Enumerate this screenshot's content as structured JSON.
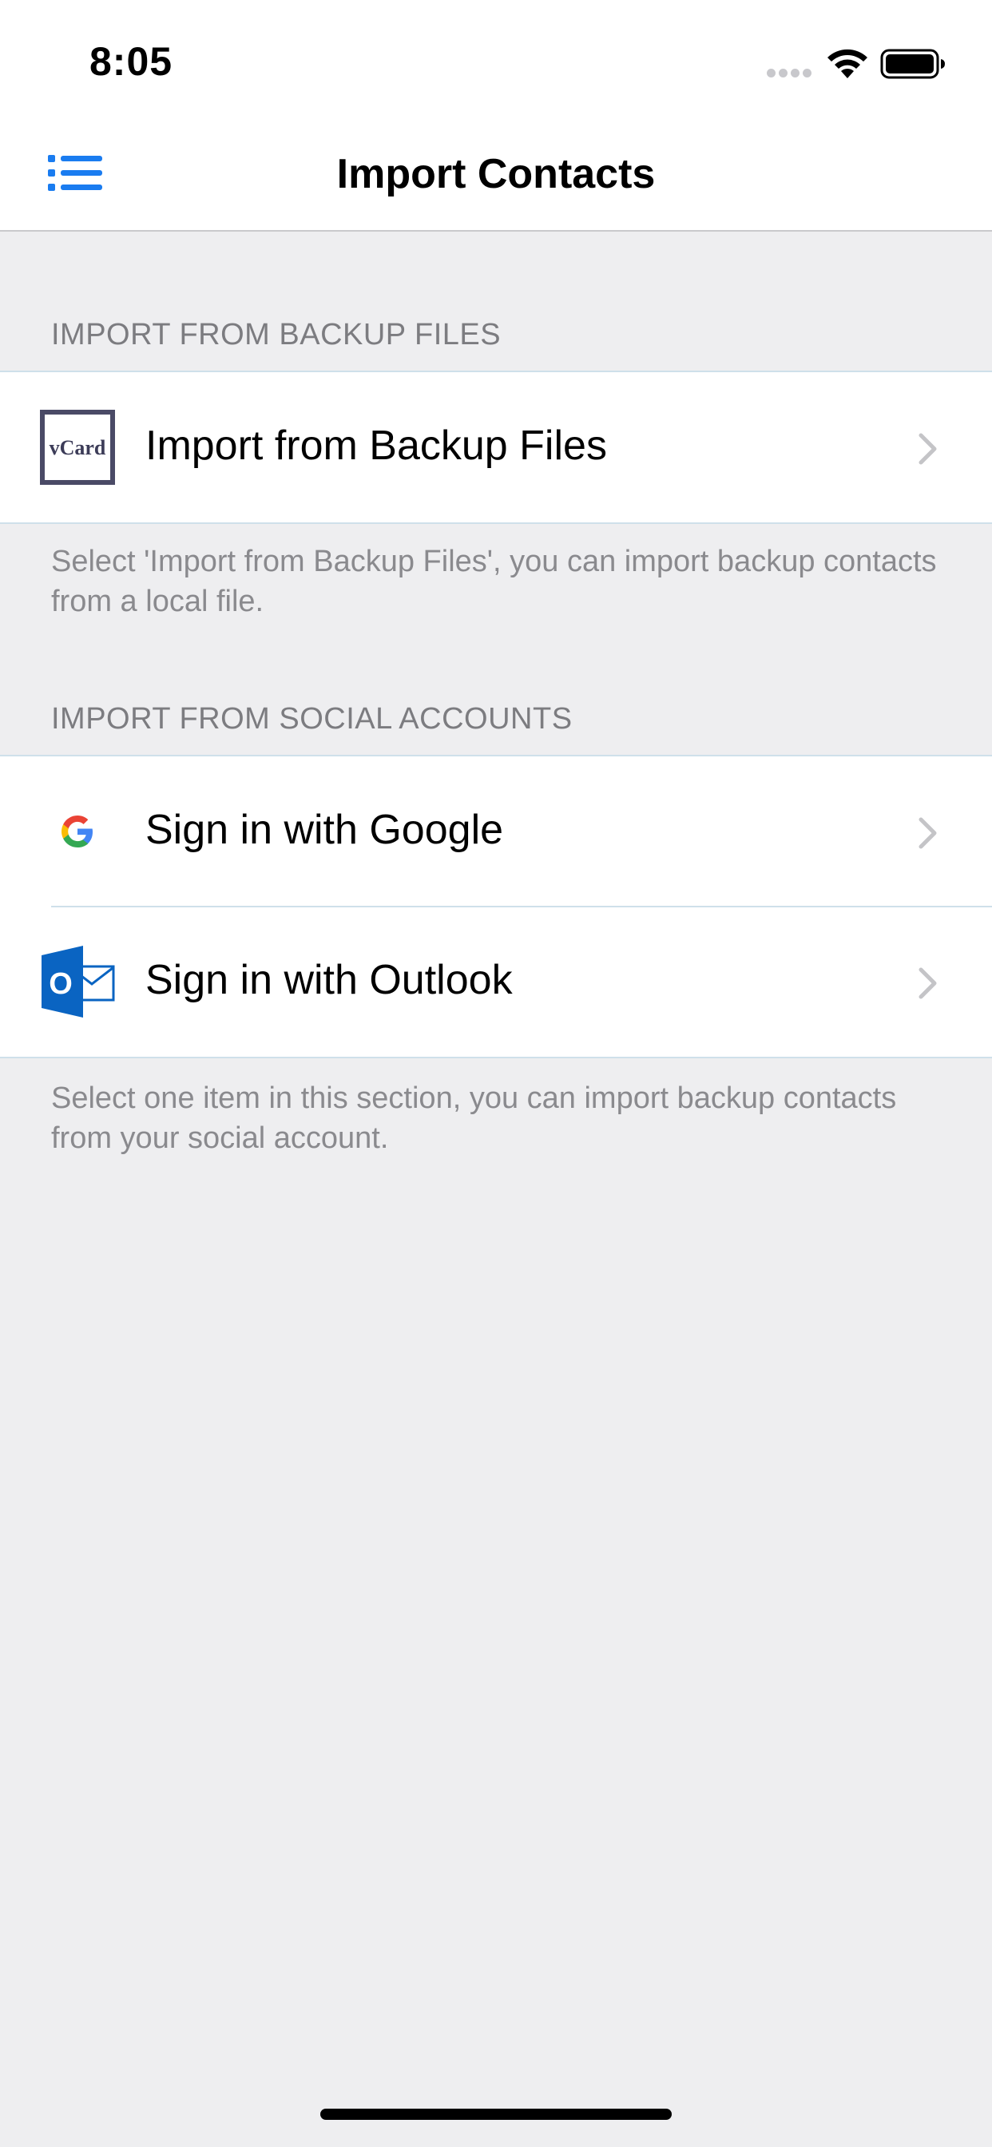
{
  "status_bar": {
    "time": "8:05",
    "icons": [
      "signal-dots-icon",
      "wifi-icon",
      "battery-icon"
    ]
  },
  "nav": {
    "title": "Import Contacts",
    "left_icon": "list-menu-icon",
    "accent_color": "#1a7cf0"
  },
  "sections": [
    {
      "header": "IMPORT FROM BACKUP FILES",
      "rows": [
        {
          "label": "Import from Backup Files",
          "icon": "vcard-icon",
          "icon_text": "vCard"
        }
      ],
      "footer": "Select 'Import from Backup Files', you can import backup contacts from a local file."
    },
    {
      "header": "IMPORT FROM SOCIAL ACCOUNTS",
      "rows": [
        {
          "label": "Sign in with Google",
          "icon": "google-icon"
        },
        {
          "label": "Sign in with Outlook",
          "icon": "outlook-icon",
          "icon_text": "O"
        }
      ],
      "footer": "Select one item in this section, you can import backup contacts from your social account."
    }
  ],
  "colors": {
    "background": "#eeeef0",
    "separator": "#cfe0ea",
    "header_text": "#7c7c80",
    "footer_text": "#8a8a8e",
    "outlook_blue": "#0a64c2",
    "vcard_border": "#4a4a66"
  }
}
